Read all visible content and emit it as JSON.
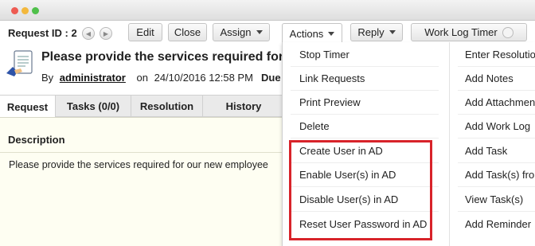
{
  "toolbar": {
    "request_id": "Request ID : 2",
    "buttons": {
      "edit": "Edit",
      "close": "Close",
      "assign": "Assign",
      "actions": "Actions",
      "reply": "Reply",
      "work_log_timer": "Work Log Timer"
    }
  },
  "request": {
    "title": "Please provide the services required for",
    "by_label": "By",
    "author": "administrator",
    "on_label": "on",
    "date": "24/10/2016 12:58 PM",
    "due_label": "Due"
  },
  "tabs": [
    "Request",
    "Tasks (0/0)",
    "Resolution",
    "History"
  ],
  "description": {
    "heading": "Description",
    "text": "Please provide the services required for our new employee"
  },
  "actions_menu": {
    "left": [
      "Stop Timer",
      "Link Requests",
      "Print Preview",
      "Delete",
      "Create User in AD",
      "Enable User(s) in AD",
      "Disable User(s) in AD",
      "Reset User Password in AD"
    ],
    "right": [
      "Enter Resolution",
      "Add Notes",
      "Add Attachment",
      "Add Work Log",
      "Add Task",
      "Add Task(s) from",
      "View Task(s)",
      "Add Reminder"
    ],
    "highlight_color": "#d8232a"
  }
}
